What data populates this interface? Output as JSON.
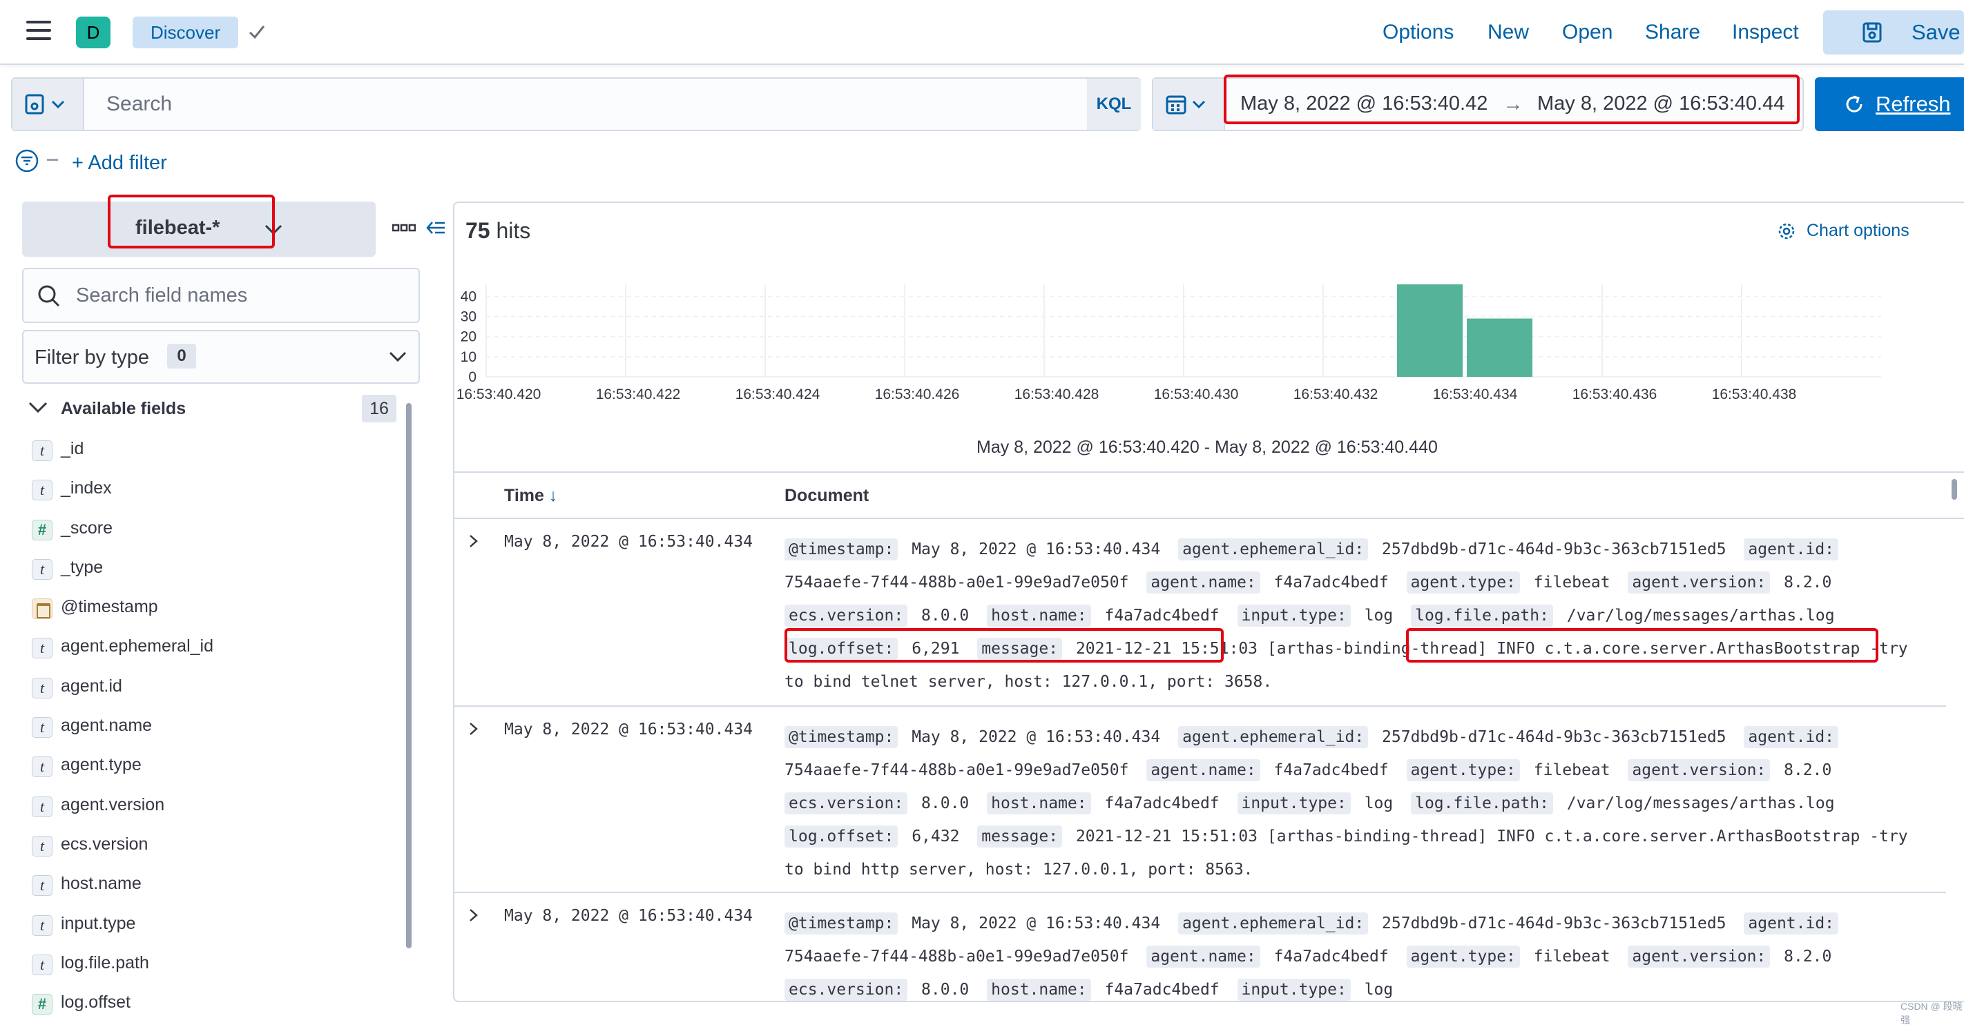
{
  "header": {
    "space_initial": "D",
    "breadcrumb": "Discover",
    "nav": [
      "Options",
      "New",
      "Open",
      "Share",
      "Inspect"
    ],
    "save_label": "Save"
  },
  "query": {
    "placeholder": "Search",
    "language": "KQL",
    "time_start": "May 8, 2022 @ 16:53:40.42",
    "time_arrow": "→",
    "time_end": "May 8, 2022 @ 16:53:40.44",
    "refresh_label": "Refresh"
  },
  "filters": {
    "add_label": "+ Add filter"
  },
  "sidebar": {
    "index_pattern": "filebeat-*",
    "search_placeholder": "Search field names",
    "filter_by_type_label": "Filter by type",
    "filter_by_type_count": "0",
    "available_label": "Available fields",
    "available_count": "16",
    "fields": [
      {
        "type": "t",
        "name": "_id"
      },
      {
        "type": "t",
        "name": "_index"
      },
      {
        "type": "#",
        "name": "_score"
      },
      {
        "type": "t",
        "name": "_type"
      },
      {
        "type": "date",
        "name": "@timestamp"
      },
      {
        "type": "t",
        "name": "agent.ephemeral_id"
      },
      {
        "type": "t",
        "name": "agent.id"
      },
      {
        "type": "t",
        "name": "agent.name"
      },
      {
        "type": "t",
        "name": "agent.type"
      },
      {
        "type": "t",
        "name": "agent.version"
      },
      {
        "type": "t",
        "name": "ecs.version"
      },
      {
        "type": "t",
        "name": "host.name"
      },
      {
        "type": "t",
        "name": "input.type"
      },
      {
        "type": "t",
        "name": "log.file.path"
      },
      {
        "type": "#",
        "name": "log.offset"
      }
    ]
  },
  "main": {
    "hits_count": "75",
    "hits_label": "hits",
    "chart_options_label": "Chart options",
    "range_label": "May 8, 2022 @ 16:53:40.420 - May 8, 2022 @ 16:53:40.440",
    "col_time": "Time",
    "col_doc": "Document",
    "rows": [
      {
        "time": "May 8, 2022 @ 16:53:40.434",
        "fields": [
          {
            "k": "@timestamp:",
            "v": "May 8, 2022 @ 16:53:40.434"
          },
          {
            "k": "agent.ephemeral_id:",
            "v": "257dbd9b-d71c-464d-9b3c-363cb7151ed5"
          },
          {
            "k": "agent.id:",
            "v": "754aaefe-7f44-488b-a0e1-99e9ad7e050f"
          },
          {
            "k": "agent.name:",
            "v": "f4a7adc4bedf"
          },
          {
            "k": "agent.type:",
            "v": "filebeat"
          },
          {
            "k": "agent.version:",
            "v": "8.2.0"
          },
          {
            "k": "ecs.version:",
            "v": "8.0.0"
          },
          {
            "k": "host.name:",
            "v": "f4a7adc4bedf"
          },
          {
            "k": "input.type:",
            "v": "log"
          },
          {
            "k": "log.file.path:",
            "v": "/var/log/messages/arthas.log"
          },
          {
            "k": "log.offset:",
            "v": "6,291"
          },
          {
            "k": "message:",
            "v": "2021-12-21 15:51:03 [arthas-binding-thread] INFO c.t.a.core.server.ArthasBootstrap -try to bind telnet server, host: 127.0.0.1, port: 3658."
          }
        ]
      },
      {
        "time": "May 8, 2022 @ 16:53:40.434",
        "fields": [
          {
            "k": "@timestamp:",
            "v": "May 8, 2022 @ 16:53:40.434"
          },
          {
            "k": "agent.ephemeral_id:",
            "v": "257dbd9b-d71c-464d-9b3c-363cb7151ed5"
          },
          {
            "k": "agent.id:",
            "v": "754aaefe-7f44-488b-a0e1-99e9ad7e050f"
          },
          {
            "k": "agent.name:",
            "v": "f4a7adc4bedf"
          },
          {
            "k": "agent.type:",
            "v": "filebeat"
          },
          {
            "k": "agent.version:",
            "v": "8.2.0"
          },
          {
            "k": "ecs.version:",
            "v": "8.0.0"
          },
          {
            "k": "host.name:",
            "v": "f4a7adc4bedf"
          },
          {
            "k": "input.type:",
            "v": "log"
          },
          {
            "k": "log.file.path:",
            "v": "/var/log/messages/arthas.log"
          },
          {
            "k": "log.offset:",
            "v": "6,432"
          },
          {
            "k": "message:",
            "v": "2021-12-21 15:51:03 [arthas-binding-thread] INFO c.t.a.core.server.ArthasBootstrap -try to bind http server, host: 127.0.0.1, port: 8563."
          }
        ]
      },
      {
        "time": "May 8, 2022 @ 16:53:40.434",
        "fields": [
          {
            "k": "@timestamp:",
            "v": "May 8, 2022 @ 16:53:40.434"
          },
          {
            "k": "agent.ephemeral_id:",
            "v": "257dbd9b-d71c-464d-9b3c-363cb7151ed5"
          },
          {
            "k": "agent.id:",
            "v": "754aaefe-7f44-488b-a0e1-99e9ad7e050f"
          },
          {
            "k": "agent.name:",
            "v": "f4a7adc4bedf"
          },
          {
            "k": "agent.type:",
            "v": "filebeat"
          },
          {
            "k": "agent.version:",
            "v": "8.2.0"
          },
          {
            "k": "ecs.version:",
            "v": "8.0.0"
          },
          {
            "k": "host.name:",
            "v": "f4a7adc4bedf"
          },
          {
            "k": "input.type:",
            "v": "log"
          }
        ]
      }
    ]
  },
  "chart_data": {
    "type": "bar",
    "x": [
      "16:53:40.420",
      "16:53:40.422",
      "16:53:40.424",
      "16:53:40.426",
      "16:53:40.428",
      "16:53:40.430",
      "16:53:40.432",
      "16:53:40.434",
      "16:53:40.436",
      "16:53:40.438"
    ],
    "bars": [
      {
        "x": "16:53:40.433",
        "value": 46
      },
      {
        "x": "16:53:40.434",
        "value": 29
      }
    ],
    "y_ticks": [
      "0",
      "10",
      "20",
      "30",
      "40"
    ],
    "ylim": [
      0,
      46
    ],
    "grid": true,
    "bar_color": "#54b399"
  },
  "colors": {
    "accent": "#0061a6",
    "primary_button": "#0072c9",
    "highlight": "#e30613"
  },
  "watermark": "CSDN @ 段晓强"
}
